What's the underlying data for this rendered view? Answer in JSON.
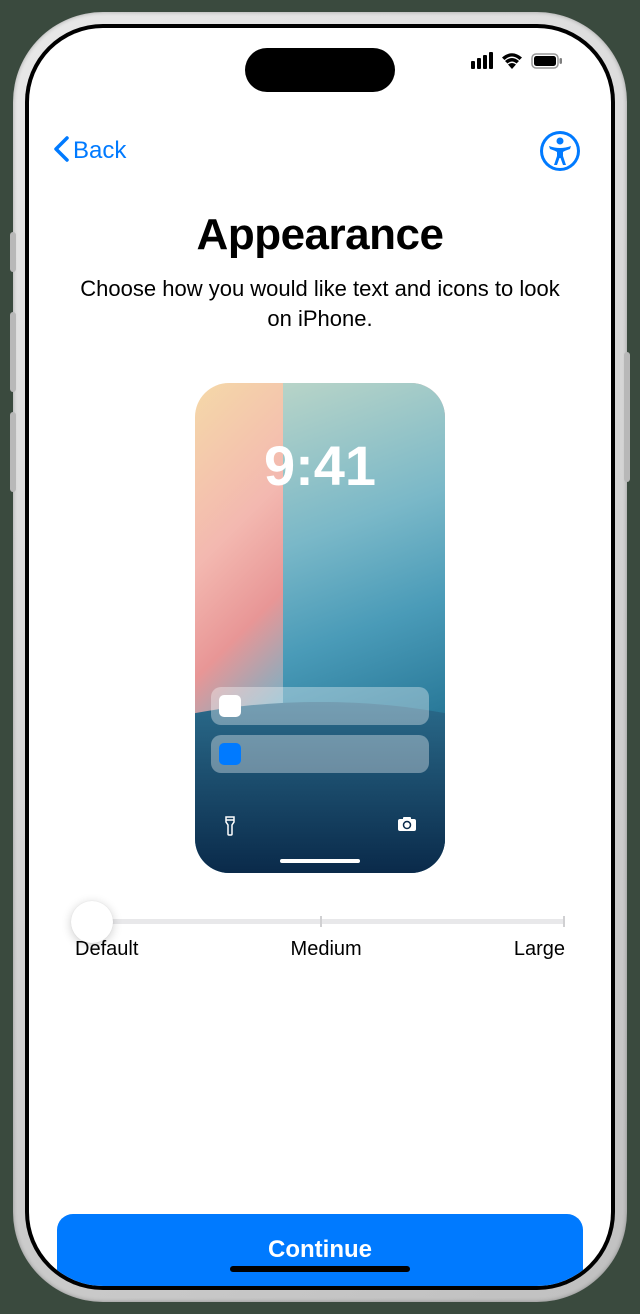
{
  "nav": {
    "back_label": "Back"
  },
  "header": {
    "title": "Appearance",
    "subtitle": "Choose how you would like text and icons to look on iPhone."
  },
  "preview": {
    "time": "9:41"
  },
  "slider": {
    "labels": {
      "default": "Default",
      "medium": "Medium",
      "large": "Large"
    }
  },
  "actions": {
    "continue_label": "Continue"
  }
}
